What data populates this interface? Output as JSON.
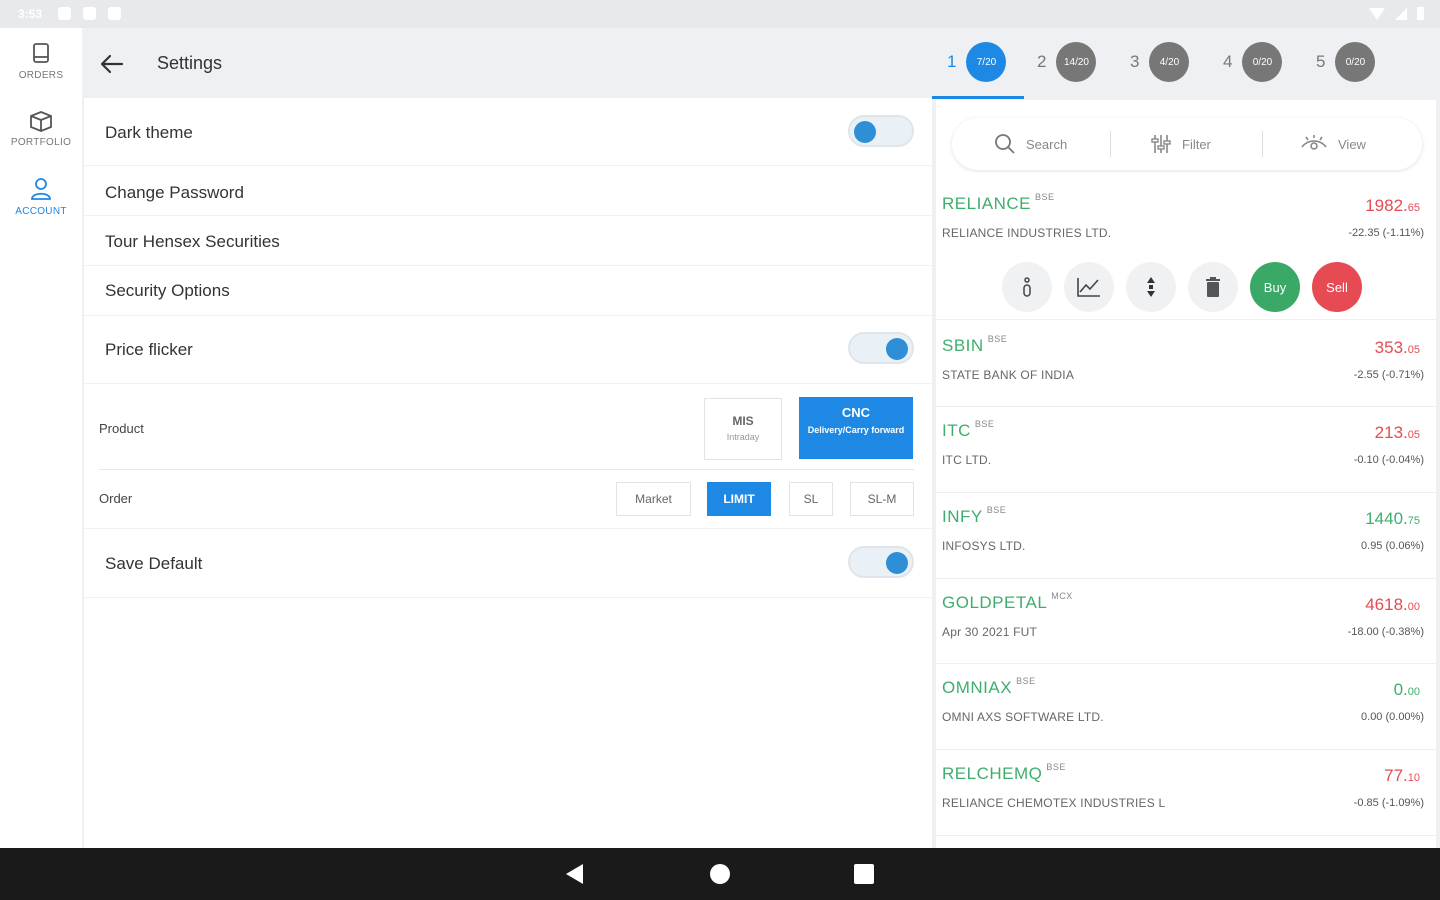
{
  "status_bar": {
    "time": "3:53"
  },
  "nav": {
    "items": [
      {
        "label": "ORDERS",
        "icon": "clipboard-icon"
      },
      {
        "label": "PORTFOLIO",
        "icon": "box-icon"
      },
      {
        "label": "ACCOUNT",
        "icon": "user-icon",
        "active": true
      }
    ]
  },
  "settings": {
    "title": "Settings",
    "dark_theme": {
      "label": "Dark theme",
      "on": false
    },
    "change_password": "Change Password",
    "tour": "Tour Hensex Securities",
    "security": "Security Options",
    "price_flicker": {
      "label": "Price flicker",
      "on": true
    },
    "product": {
      "label": "Product",
      "mis_title": "MIS",
      "mis_sub": "Intraday",
      "cnc_title": "CNC",
      "cnc_sub": "Delivery/Carry forward",
      "selected": "CNC"
    },
    "order": {
      "label": "Order",
      "options": [
        "Market",
        "LIMIT",
        "SL",
        "SL-M"
      ],
      "selected": "LIMIT"
    },
    "save_default": {
      "label": "Save Default",
      "on": true
    }
  },
  "watchlist": {
    "tabs": [
      {
        "num": "1",
        "count": "7/20",
        "active": true
      },
      {
        "num": "2",
        "count": "14/20"
      },
      {
        "num": "3",
        "count": "4/20"
      },
      {
        "num": "4",
        "count": "0/20"
      },
      {
        "num": "5",
        "count": "0/20"
      }
    ],
    "toolbar": {
      "search": "Search",
      "filter": "Filter",
      "view": "View"
    },
    "actions": {
      "buy": "Buy",
      "sell": "Sell"
    },
    "stocks": [
      {
        "symbol": "RELIANCE",
        "exchange": "BSE",
        "name": "RELIANCE INDUSTRIES LTD.",
        "price_main": "1982.",
        "price_dec": "65",
        "change": "-22.35 (-1.11%)",
        "direction": "down"
      },
      {
        "symbol": "SBIN",
        "exchange": "BSE",
        "name": "STATE BANK OF INDIA",
        "price_main": "353.",
        "price_dec": "05",
        "change": "-2.55 (-0.71%)",
        "direction": "down"
      },
      {
        "symbol": "ITC",
        "exchange": "BSE",
        "name": "ITC LTD.",
        "price_main": "213.",
        "price_dec": "05",
        "change": "-0.10 (-0.04%)",
        "direction": "down"
      },
      {
        "symbol": "INFY",
        "exchange": "BSE",
        "name": "INFOSYS LTD.",
        "price_main": "1440.",
        "price_dec": "75",
        "change": "0.95 (0.06%)",
        "direction": "up"
      },
      {
        "symbol": "GOLDPETAL",
        "exchange": "MCX",
        "name": "Apr 30 2021 FUT",
        "price_main": "4618.",
        "price_dec": "00",
        "change": "-18.00 (-0.38%)",
        "direction": "down"
      },
      {
        "symbol": "OMNIAX",
        "exchange": "BSE",
        "name": "OMNI AXS SOFTWARE LTD.",
        "price_main": "0.",
        "price_dec": "00",
        "change": "0.00 (0.00%)",
        "direction": "up"
      },
      {
        "symbol": "RELCHEMQ",
        "exchange": "BSE",
        "name": "RELIANCE CHEMOTEX INDUSTRIES L",
        "price_main": "77.",
        "price_dec": "10",
        "change": "-0.85 (-1.09%)",
        "direction": "down"
      }
    ]
  }
}
